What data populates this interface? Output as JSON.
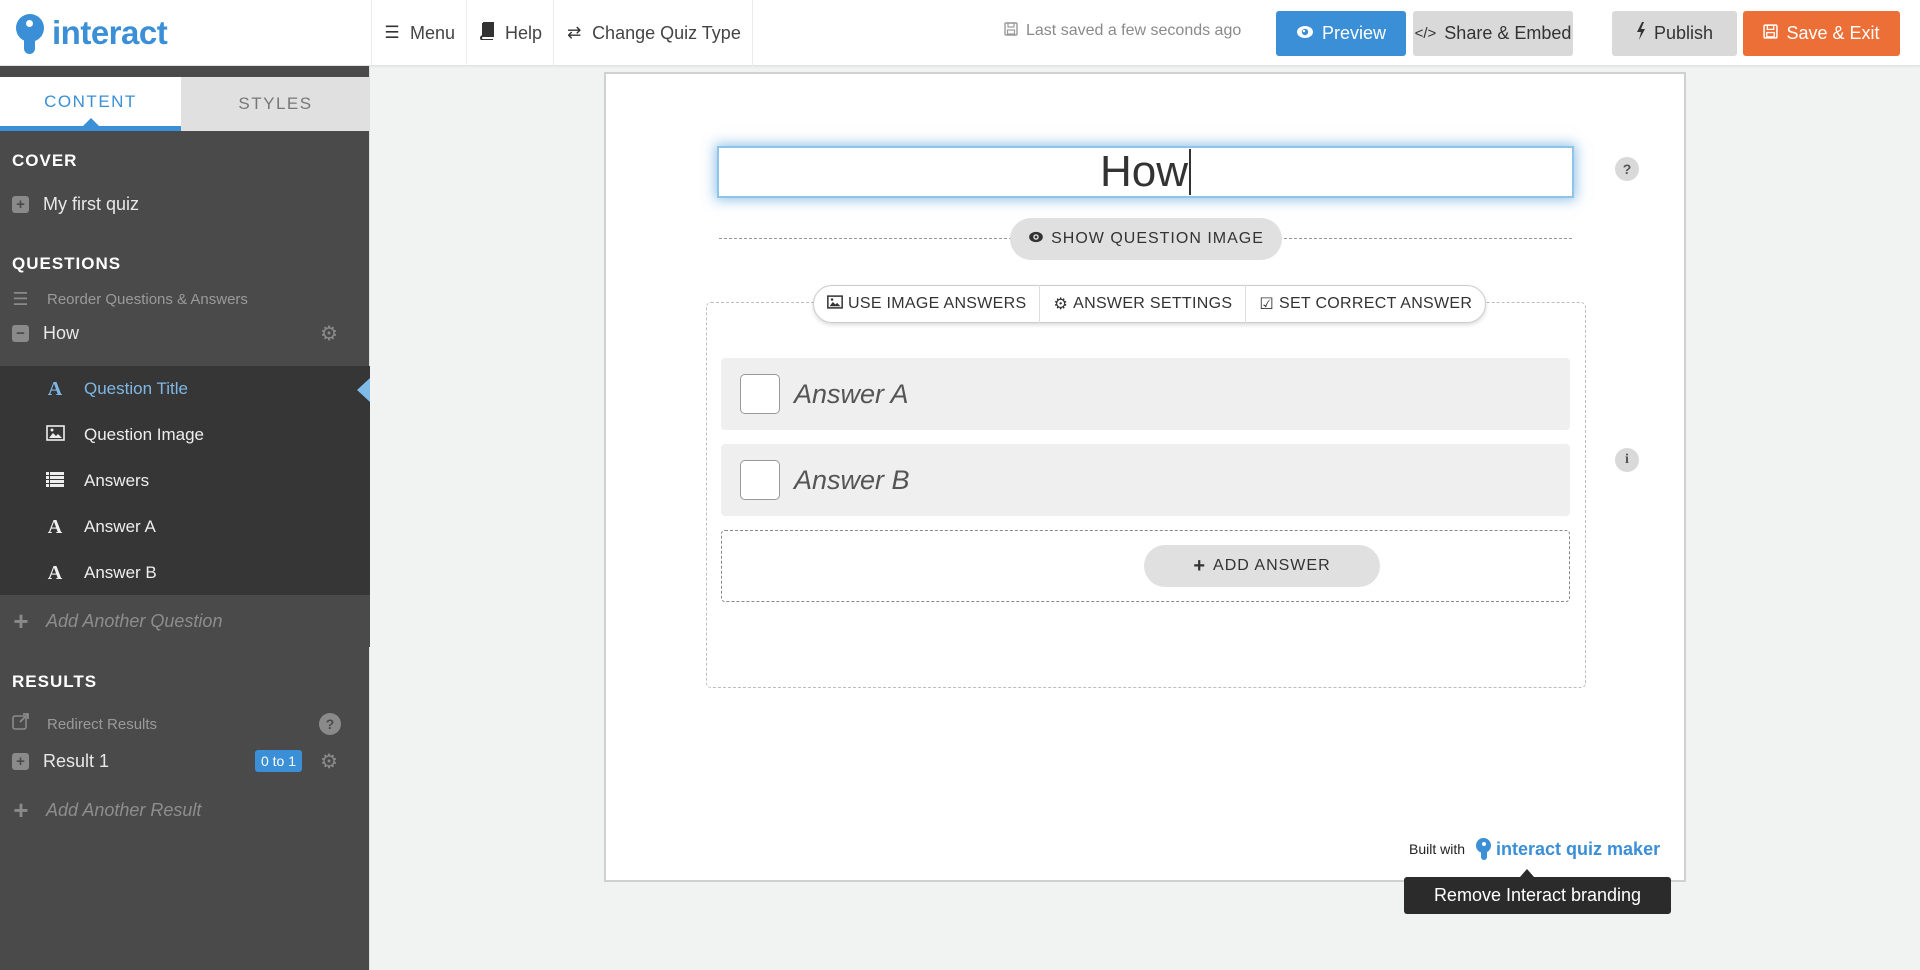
{
  "app": {
    "logo_text": "interact"
  },
  "nav": [
    {
      "icon": "menu-icon",
      "glyph": "☰",
      "label": "Menu"
    },
    {
      "icon": "book-icon",
      "glyph": "📘",
      "label": "Help"
    },
    {
      "icon": "exchange-icon",
      "glyph": "⇄",
      "label": "Change Quiz Type"
    }
  ],
  "status": {
    "saved_text": "Last saved a few seconds ago",
    "glyph": "💾"
  },
  "toolbar": {
    "preview": {
      "label": "Preview",
      "glyph": "◉",
      "color": "#3a8fd6"
    },
    "share": {
      "label": "Share & Embed",
      "glyph": "</>"
    },
    "publish": {
      "label": "Publish",
      "glyph": "ϟ"
    },
    "save_exit": {
      "label": "Save & Exit",
      "glyph": "💾",
      "color": "#ec6f37"
    }
  },
  "sidebar": {
    "tabs": [
      {
        "label": "CONTENT",
        "active": true
      },
      {
        "label": "STYLES",
        "active": false
      }
    ],
    "cover": {
      "heading": "COVER",
      "item": {
        "label": "My first quiz",
        "glyph": "+"
      }
    },
    "questions": {
      "heading": "QUESTIONS",
      "reorder_label": "Reorder Questions & Answers",
      "question": {
        "label": "How",
        "glyph": "−"
      },
      "sub_items": [
        {
          "label": "Question Title",
          "icon": "text-icon",
          "glyph": "A",
          "active": true
        },
        {
          "label": "Question Image",
          "icon": "image-icon",
          "glyph": "🖼",
          "active": false
        },
        {
          "label": "Answers",
          "icon": "list-icon",
          "glyph": "☷",
          "active": false
        },
        {
          "label": "Answer A",
          "icon": "text-icon",
          "glyph": "A",
          "active": false
        },
        {
          "label": "Answer B",
          "icon": "text-icon",
          "glyph": "A",
          "active": false
        }
      ],
      "add_label": "Add Another Question"
    },
    "results": {
      "heading": "RESULTS",
      "redirect_label": "Redirect Results",
      "result": {
        "label": "Result 1",
        "badge": "0 to 1",
        "glyph": "+"
      },
      "add_label": "Add Another Result"
    }
  },
  "editor": {
    "question_title": "How",
    "show_image_label": "SHOW QUESTION IMAGE",
    "answer_tools": [
      {
        "label": "USE IMAGE ANSWERS",
        "icon": "image-icon",
        "glyph": "🖼"
      },
      {
        "label": "ANSWER SETTINGS",
        "icon": "gear-icon",
        "glyph": "⚙"
      },
      {
        "label": "SET CORRECT ANSWER",
        "icon": "check-square-icon",
        "glyph": "☑"
      }
    ],
    "answers": [
      {
        "text": "Answer A",
        "checked": false
      },
      {
        "text": "Answer B",
        "checked": false
      }
    ],
    "add_answer_label": "ADD ANSWER",
    "help_glyph": "?",
    "info_glyph": "i"
  },
  "branding": {
    "built_with": "Built with",
    "brand_text": "interact quiz maker",
    "tooltip": "Remove Interact branding"
  }
}
